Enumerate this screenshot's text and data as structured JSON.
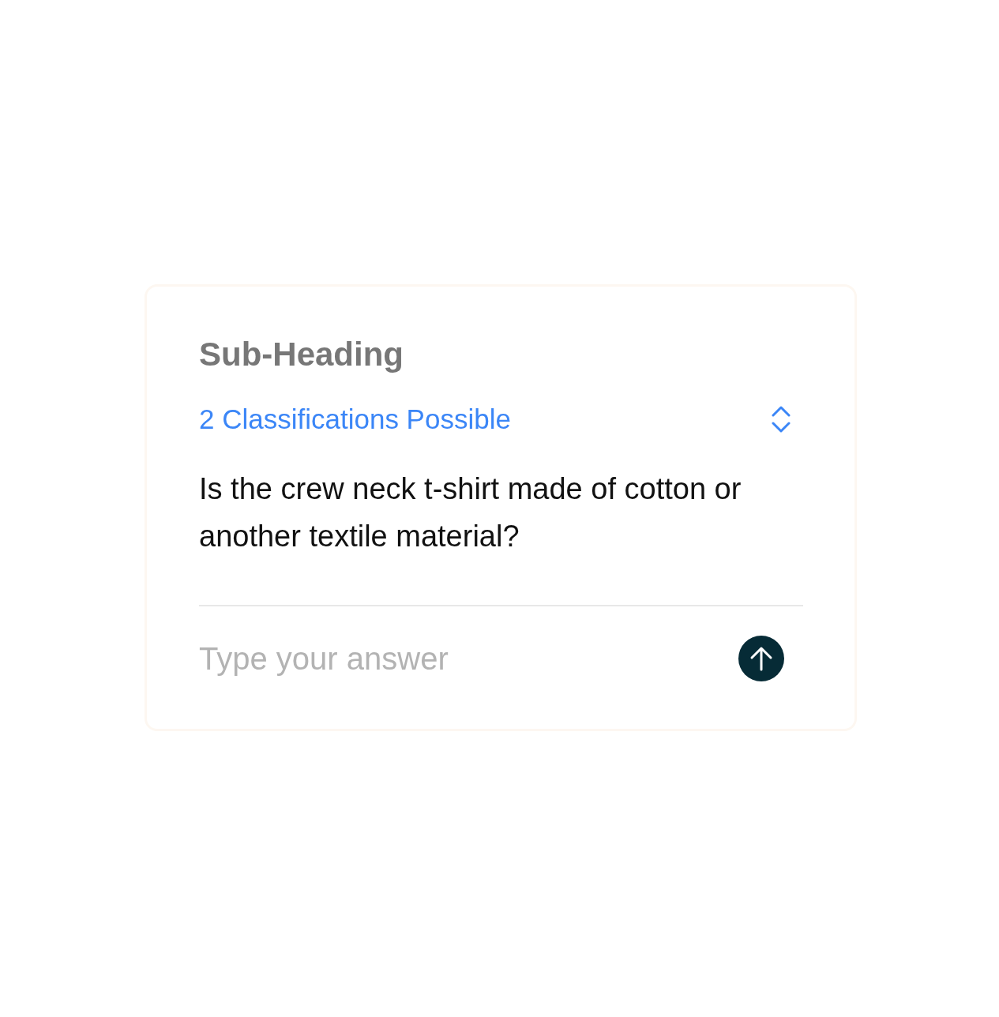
{
  "card": {
    "heading": "Sub-Heading",
    "dropdown": {
      "label": "2 Classifications Possible"
    },
    "question": "Is the crew neck t-shirt made of cotton or another textile material?",
    "answer_field": {
      "placeholder": "Type your answer"
    }
  }
}
